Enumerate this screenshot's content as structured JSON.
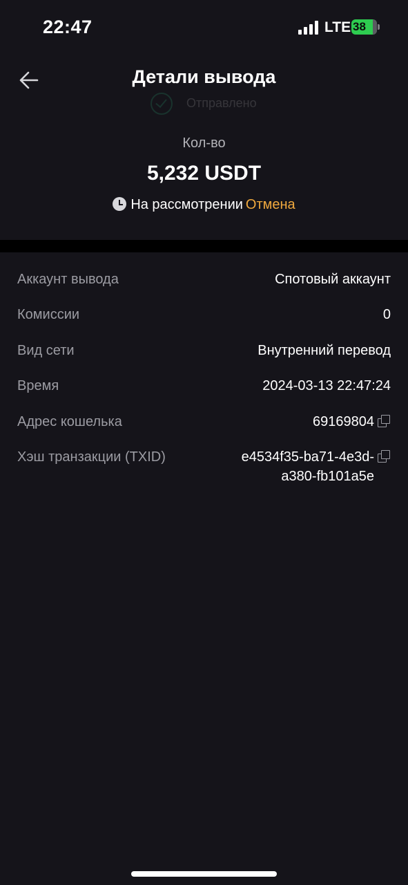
{
  "status_bar": {
    "time": "22:47",
    "network": "LTE",
    "battery": "38"
  },
  "header": {
    "title": "Детали вывода",
    "ghost_status": "Отправлено"
  },
  "summary": {
    "amount_label": "Кол-во",
    "amount": "5,232 USDT",
    "status": "На рассмотрении",
    "cancel_label": "Отмена"
  },
  "details": {
    "account_label": "Аккаунт вывода",
    "account_value": "Спотовый аккаунт",
    "fee_label": "Комиссии",
    "fee_value": "0",
    "network_label": "Вид сети",
    "network_value": "Внутренний перевод",
    "time_label": "Время",
    "time_value": "2024-03-13 22:47:24",
    "address_label": "Адрес кошелька",
    "address_value": "69169804",
    "txid_label": "Хэш транзакции (TXID)",
    "txid_line1": "e4534f35-ba71-4e3d-",
    "txid_line2": "a380-fb101a5e"
  },
  "colors": {
    "background": "#15141a",
    "accent": "#f0a93e",
    "muted_text": "#9c9ca3",
    "battery": "#2ecc50"
  },
  "icons": [
    "back-arrow-icon",
    "check-circle-icon",
    "clock-icon",
    "copy-icon",
    "signal-icon",
    "battery-icon"
  ]
}
